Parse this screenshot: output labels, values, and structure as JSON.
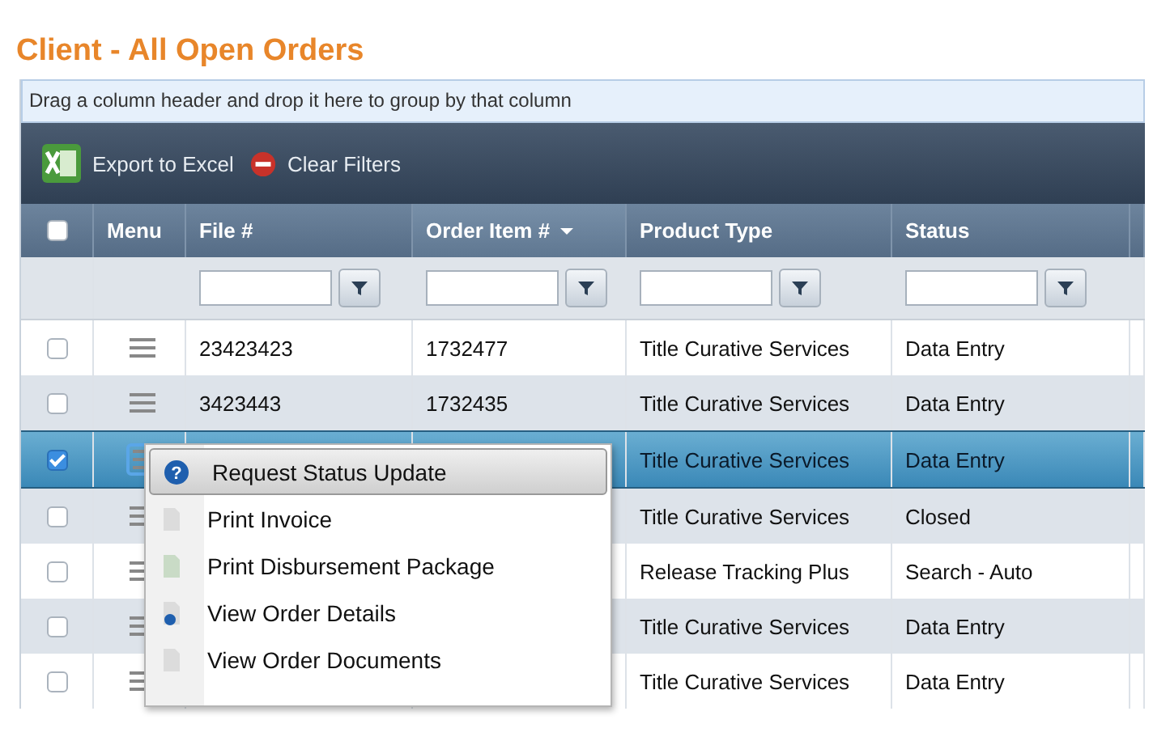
{
  "title": "Client - All Open Orders",
  "group_hint": "Drag a column header and drop it here to group by that column",
  "toolbar": [
    {
      "kind": "excel",
      "label": "Export to Excel"
    },
    {
      "kind": "clear",
      "label": "Clear Filters"
    }
  ],
  "header": {
    "select_all_checked": false,
    "columns": [
      {
        "label": "Menu",
        "filter": false,
        "sorted": false
      },
      {
        "label": "File #",
        "filter": true,
        "sorted": false
      },
      {
        "label": "Order Item #",
        "filter": true,
        "sorted": true
      },
      {
        "label": "Product Type",
        "filter": true,
        "sorted": false
      },
      {
        "label": "Status",
        "filter": true,
        "sorted": false
      }
    ]
  },
  "rows": [
    {
      "checked": false,
      "selected": false,
      "file": "23423423",
      "order_item": "1732477",
      "product_type": "Title Curative Services",
      "status": "Data Entry"
    },
    {
      "checked": false,
      "selected": false,
      "file": "3423443",
      "order_item": "1732435",
      "product_type": "Title Curative Services",
      "status": "Data Entry"
    },
    {
      "checked": true,
      "selected": true,
      "product_type": "Title Curative Services",
      "status": "Data Entry"
    },
    {
      "checked": false,
      "selected": false,
      "product_type": "Title Curative Services",
      "status": "Closed"
    },
    {
      "checked": false,
      "selected": false,
      "product_type": "Release Tracking Plus",
      "status": "Search - Auto"
    },
    {
      "checked": false,
      "selected": false,
      "product_type": "Title Curative Services",
      "status": "Data Entry"
    },
    {
      "checked": false,
      "selected": false,
      "product_type": "Title Curative Services",
      "status": "Data Entry"
    }
  ],
  "context_menu": [
    {
      "kind": "help",
      "glyph": "?",
      "label": "Request Status Update",
      "selected": true
    },
    {
      "kind": "page",
      "label": "Print Invoice",
      "selected": false
    },
    {
      "kind": "green-page",
      "label": "Print Disbursement Package",
      "selected": false
    },
    {
      "kind": "info-page",
      "label": "View Order Details",
      "selected": false
    },
    {
      "kind": "page",
      "label": "View Order Documents",
      "selected": false
    }
  ]
}
